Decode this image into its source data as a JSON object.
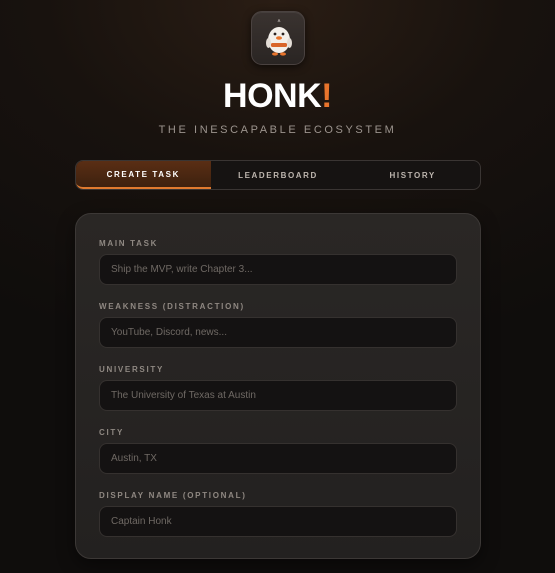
{
  "app": {
    "brand_text": "HONK",
    "brand_accent": "!",
    "tagline": "THE INESCAPABLE ECOSYSTEM",
    "logo_icon": "goose-mascot-icon",
    "accent_color": "#e8742c"
  },
  "tabs": [
    {
      "label": "CREATE TASK",
      "active": true
    },
    {
      "label": "LEADERBOARD",
      "active": false
    },
    {
      "label": "HISTORY",
      "active": false
    }
  ],
  "form": {
    "main_task": {
      "label": "MAIN TASK",
      "placeholder": "Ship the MVP, write Chapter 3..."
    },
    "weakness": {
      "label": "WEAKNESS (DISTRACTION)",
      "placeholder": "YouTube, Discord, news..."
    },
    "university": {
      "label": "UNIVERSITY",
      "placeholder": "The University of Texas at Austin"
    },
    "city": {
      "label": "CITY",
      "placeholder": "Austin, TX"
    },
    "display_name": {
      "label": "DISPLAY NAME (OPTIONAL)",
      "placeholder": "Captain Honk"
    }
  }
}
